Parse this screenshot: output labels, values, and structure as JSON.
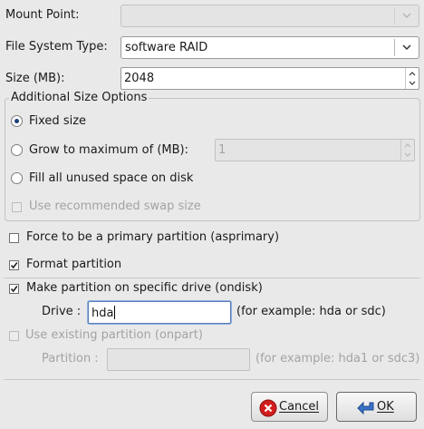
{
  "mount_point": {
    "label": "Mount Point:",
    "value": ""
  },
  "fs_type": {
    "label": "File System Type:",
    "value": "software RAID"
  },
  "size": {
    "label": "Size (MB):",
    "value": "2048"
  },
  "size_options": {
    "title": "Additional Size Options",
    "fixed": "Fixed size",
    "grow": "Grow to maximum of (MB):",
    "grow_value": "1",
    "fill": "Fill all unused space on disk",
    "swap": "Use recommended swap size"
  },
  "primary": {
    "label": "Force to be a primary partition (asprimary)",
    "checked": false
  },
  "format": {
    "label": "Format partition",
    "checked": true
  },
  "ondisk": {
    "label": "Make partition on specific drive (ondisk)",
    "checked": true,
    "drive_label": "Drive :",
    "drive_value": "hda",
    "drive_hint": "(for example: hda or sdc)"
  },
  "onpart": {
    "label": "Use existing partition (onpart)",
    "partition_label": "Partition :",
    "partition_value": "",
    "partition_hint": "(for example: hda1 or sdc3)"
  },
  "buttons": {
    "cancel": "Cancel",
    "ok": "OK"
  },
  "colors": {
    "cancel_icon": "#d21e1e",
    "ok_icon": "#3b73c8",
    "accent": "#1f3f7c"
  },
  "icons": {
    "cancel": "cancel-icon",
    "ok": "ok-icon",
    "dropdown": "chevron-down-icon"
  }
}
